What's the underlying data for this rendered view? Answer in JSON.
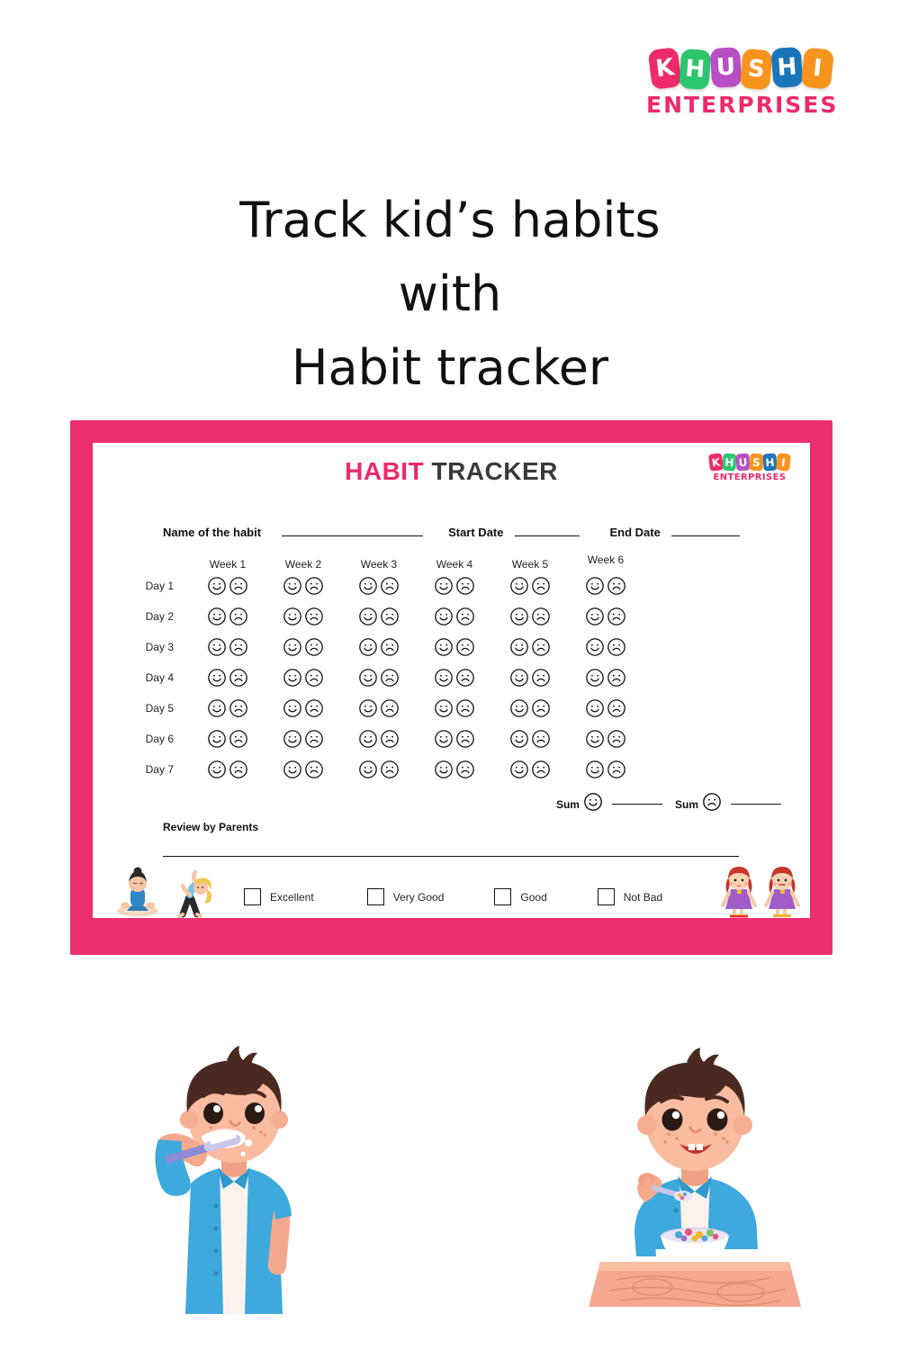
{
  "brand": {
    "name_letters": [
      "K",
      "H",
      "U",
      "S",
      "H",
      "I"
    ],
    "letter_colors": [
      "#ED2A6A",
      "#2DC66E",
      "#B94FC4",
      "#F7941E",
      "#1B75BB",
      "#F7941E"
    ],
    "subtitle": "ENTERPRISES",
    "subtitle_color": "#ED2A6A"
  },
  "headline": {
    "line1": "Track kid’s habits",
    "line2": "with",
    "line3": "Habit tracker"
  },
  "card": {
    "border_color": "#ED2E70",
    "sheet_bg": "#FFFFFF",
    "title_accent": "HABIT",
    "title_rest": " TRACKER",
    "accent_color": "#ED2A6A"
  },
  "form": {
    "habit_label": "Name of the habit",
    "habit_value": "",
    "start_label": "Start Date",
    "start_value": "",
    "end_label": "End Date",
    "end_value": ""
  },
  "tracker": {
    "weeks": [
      "Week 1",
      "Week 2",
      "Week 3",
      "Week 4",
      "Week 5",
      "Week 6"
    ],
    "days": [
      "Day 1",
      "Day 2",
      "Day 3",
      "Day 4",
      "Day 5",
      "Day 6",
      "Day 7"
    ],
    "faces": [
      "happy-face",
      "sad-face"
    ]
  },
  "sum": {
    "happy_label": "Sum",
    "happy_value": "",
    "sad_label": "Sum",
    "sad_value": ""
  },
  "review": {
    "label": "Review by Parents",
    "value": ""
  },
  "ratings": [
    {
      "label": "Excellent",
      "checked": false
    },
    {
      "label": "Very Good",
      "checked": false
    },
    {
      "label": "Good",
      "checked": false
    },
    {
      "label": "Not Bad",
      "checked": false
    }
  ],
  "illustrations": {
    "sheet_left": "kids-yoga",
    "sheet_right": "two-girls",
    "bottom_left": "boy-brushing-teeth",
    "bottom_right": "boy-eating-cereal"
  }
}
